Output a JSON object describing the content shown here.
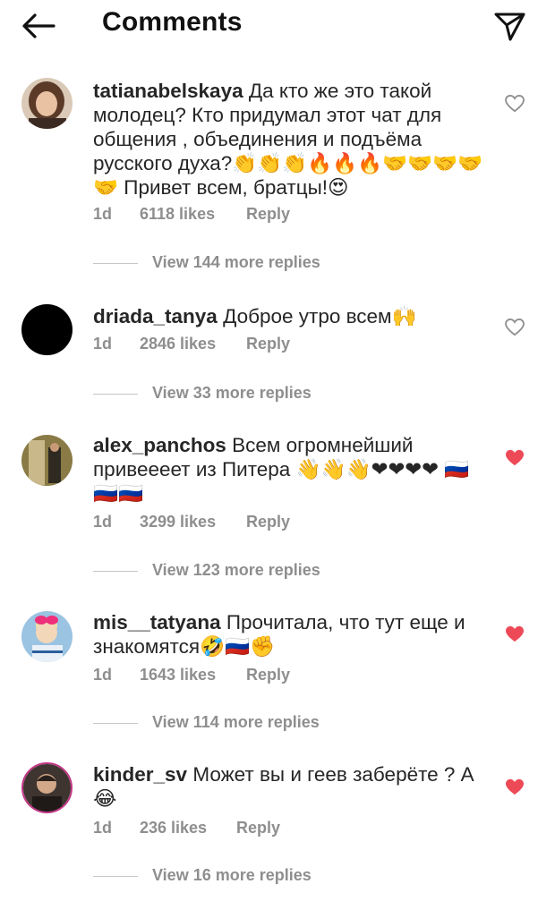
{
  "header": {
    "title": "Comments",
    "back_icon": "arrow-left-icon",
    "send_icon": "paper-plane-icon"
  },
  "comments": [
    {
      "username": "tatianabelskaya",
      "text": "Да кто же это такой молодец? Кто придумал этот чат для общения , объединения и подъёма русского духа?👏👏👏🔥🔥🔥🤝🤝🤝🤝🤝 Привет всем, братцы!😍",
      "time": "1d",
      "likes": "6118 likes",
      "reply": "Reply",
      "liked": false,
      "replies": "View 144 more replies",
      "avatar_color": "#b08060"
    },
    {
      "username": "driada_tanya",
      "text": "Доброе утро всем🙌",
      "time": "1d",
      "likes": "2846 likes",
      "reply": "Reply",
      "liked": false,
      "replies": "View 33 more replies",
      "avatar_color": "#000000"
    },
    {
      "username": "alex_panchos",
      "text": "Всем огромнейший привеееет из Питера 👋👋👋❤❤❤❤ 🇷🇺🇷🇺🇷🇺",
      "time": "1d",
      "likes": "3299 likes",
      "reply": "Reply",
      "liked": true,
      "replies": "View 123 more replies",
      "avatar_color": "#7a6a3a"
    },
    {
      "username": "mis__tatyana",
      "text": "Прочитала, что тут еще и знакомятся🤣🇷🇺✊",
      "time": "1d",
      "likes": "1643 likes",
      "reply": "Reply",
      "liked": true,
      "replies": "View 114 more replies",
      "avatar_color": "#6fa0c8"
    },
    {
      "username": "kinder_sv",
      "text": "Может вы и геев заберёте ? А 😂",
      "time": "1d",
      "likes": "236 likes",
      "reply": "Reply",
      "liked": true,
      "replies": "View 16 more replies",
      "avatar_color": "#5a4a3e"
    }
  ],
  "colors": {
    "liked_heart": "#ed4956",
    "muted": "#8e8e8e",
    "text": "#262626"
  }
}
